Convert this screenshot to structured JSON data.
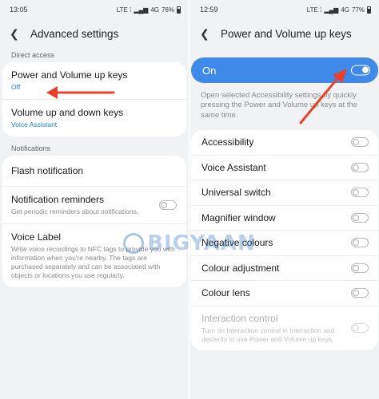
{
  "left": {
    "status": {
      "time": "13:05",
      "net": "LTE ⁞",
      "signal": "4G",
      "battery": "76%"
    },
    "header": {
      "title": "Advanced settings"
    },
    "sections": {
      "direct_access": "Direct access",
      "notifications": "Notifications"
    },
    "power_volume": {
      "title": "Power and Volume up keys",
      "sub": "Off"
    },
    "volume_up_down": {
      "title": "Volume up and down keys",
      "sub": "Voice Assistant"
    },
    "flash_notification": {
      "title": "Flash notification"
    },
    "notification_reminders": {
      "title": "Notification reminders",
      "sub": "Get periodic reminders about notifications."
    },
    "voice_label": {
      "title": "Voice Label",
      "sub": "Write voice recordings to NFC tags to provide you with information when you're nearby. The tags are purchased separately and can be associated with objects or locations you use regularly."
    }
  },
  "right": {
    "status": {
      "time": "12:59",
      "net": "LTE ⁞",
      "signal": "4G",
      "battery": "77%"
    },
    "header": {
      "title": "Power and Volume up keys"
    },
    "master": {
      "label": "On"
    },
    "description": "Open selected Accessibility settings by quickly pressing the Power and Volume up keys at the same time.",
    "options": [
      {
        "label": "Accessibility"
      },
      {
        "label": "Voice Assistant"
      },
      {
        "label": "Universal switch"
      },
      {
        "label": "Magnifier window"
      },
      {
        "label": "Negative colours"
      },
      {
        "label": "Colour adjustment"
      },
      {
        "label": "Colour lens"
      }
    ],
    "interaction_control": {
      "title": "Interaction control",
      "sub": "Turn on Interaction control in Interaction and dexterity to use Power and Volume up keys."
    }
  },
  "watermark": {
    "text": "BIGYAAN"
  },
  "colors": {
    "accent": "#3f89e8",
    "arrow": "#e8412b",
    "sub_link": "#1c7fd4"
  }
}
